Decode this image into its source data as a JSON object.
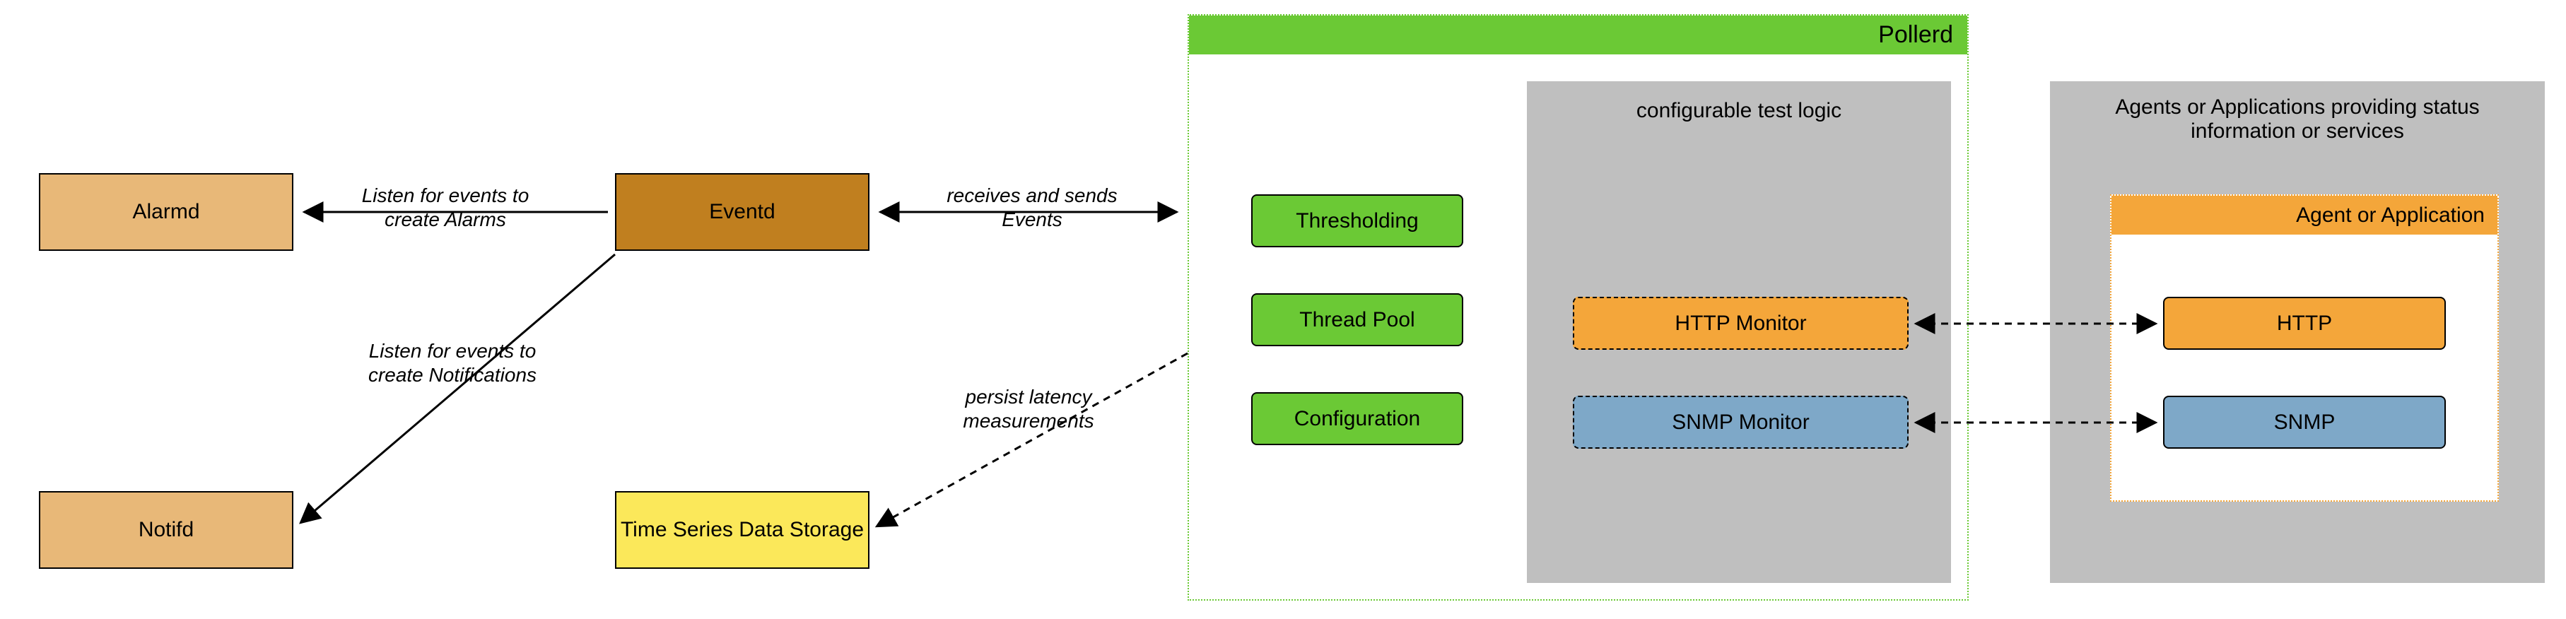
{
  "boxes": {
    "alarmd": "Alarmd",
    "notifd": "Notifd",
    "eventd": "Eventd",
    "tsds": "Time Series Data Storage",
    "thresholding": "Thresholding",
    "threadpool": "Thread Pool",
    "configuration": "Configuration",
    "httpMonitor": "HTTP Monitor",
    "snmpMonitor": "SNMP Monitor",
    "http": "HTTP",
    "snmp": "SNMP"
  },
  "labels": {
    "alarms": "Listen for events to create Alarms",
    "notifications": "Listen for events to create Notifications",
    "receives": "receives and sends Events",
    "persist": "persist latency measurements",
    "pollerd": "Pollerd",
    "configurable": "configurable test logic",
    "agents": "Agents or Applications providing status information or services",
    "agentApp": "Agent or Application"
  },
  "chart_data": {
    "type": "diagram",
    "title": "Pollerd architecture overview",
    "nodes": [
      {
        "id": "alarmd",
        "label": "Alarmd",
        "group": "daemons"
      },
      {
        "id": "notifd",
        "label": "Notifd",
        "group": "daemons"
      },
      {
        "id": "eventd",
        "label": "Eventd",
        "group": "daemons"
      },
      {
        "id": "tsds",
        "label": "Time Series Data Storage",
        "group": "storage"
      },
      {
        "id": "pollerd",
        "label": "Pollerd",
        "group": "container",
        "children": [
          "thresholding",
          "threadpool",
          "configuration",
          "configurable-test-logic"
        ]
      },
      {
        "id": "thresholding",
        "label": "Thresholding",
        "group": "pollerd-core"
      },
      {
        "id": "threadpool",
        "label": "Thread Pool",
        "group": "pollerd-core"
      },
      {
        "id": "configuration",
        "label": "Configuration",
        "group": "pollerd-core"
      },
      {
        "id": "configurable-test-logic",
        "label": "configurable test logic",
        "group": "container",
        "children": [
          "httpMonitor",
          "snmpMonitor"
        ]
      },
      {
        "id": "httpMonitor",
        "label": "HTTP Monitor",
        "group": "monitor"
      },
      {
        "id": "snmpMonitor",
        "label": "SNMP Monitor",
        "group": "monitor"
      },
      {
        "id": "agents",
        "label": "Agents or Applications providing status information or services",
        "group": "container",
        "children": [
          "agentApp"
        ]
      },
      {
        "id": "agentApp",
        "label": "Agent or Application",
        "group": "container",
        "children": [
          "http",
          "snmp"
        ]
      },
      {
        "id": "http",
        "label": "HTTP",
        "group": "service"
      },
      {
        "id": "snmp",
        "label": "SNMP",
        "group": "service"
      }
    ],
    "edges": [
      {
        "from": "eventd",
        "to": "alarmd",
        "label": "Listen for events to create Alarms",
        "style": "solid",
        "direction": "one"
      },
      {
        "from": "eventd",
        "to": "notifd",
        "label": "Listen for events to create Notifications",
        "style": "solid",
        "direction": "one"
      },
      {
        "from": "eventd",
        "to": "pollerd",
        "label": "receives and sends Events",
        "style": "solid",
        "direction": "both"
      },
      {
        "from": "pollerd",
        "to": "tsds",
        "label": "persist latency measurements",
        "style": "dashed",
        "direction": "one"
      },
      {
        "from": "httpMonitor",
        "to": "http",
        "label": "",
        "style": "dashed",
        "direction": "both"
      },
      {
        "from": "snmpMonitor",
        "to": "snmp",
        "label": "",
        "style": "dashed",
        "direction": "both"
      }
    ]
  }
}
